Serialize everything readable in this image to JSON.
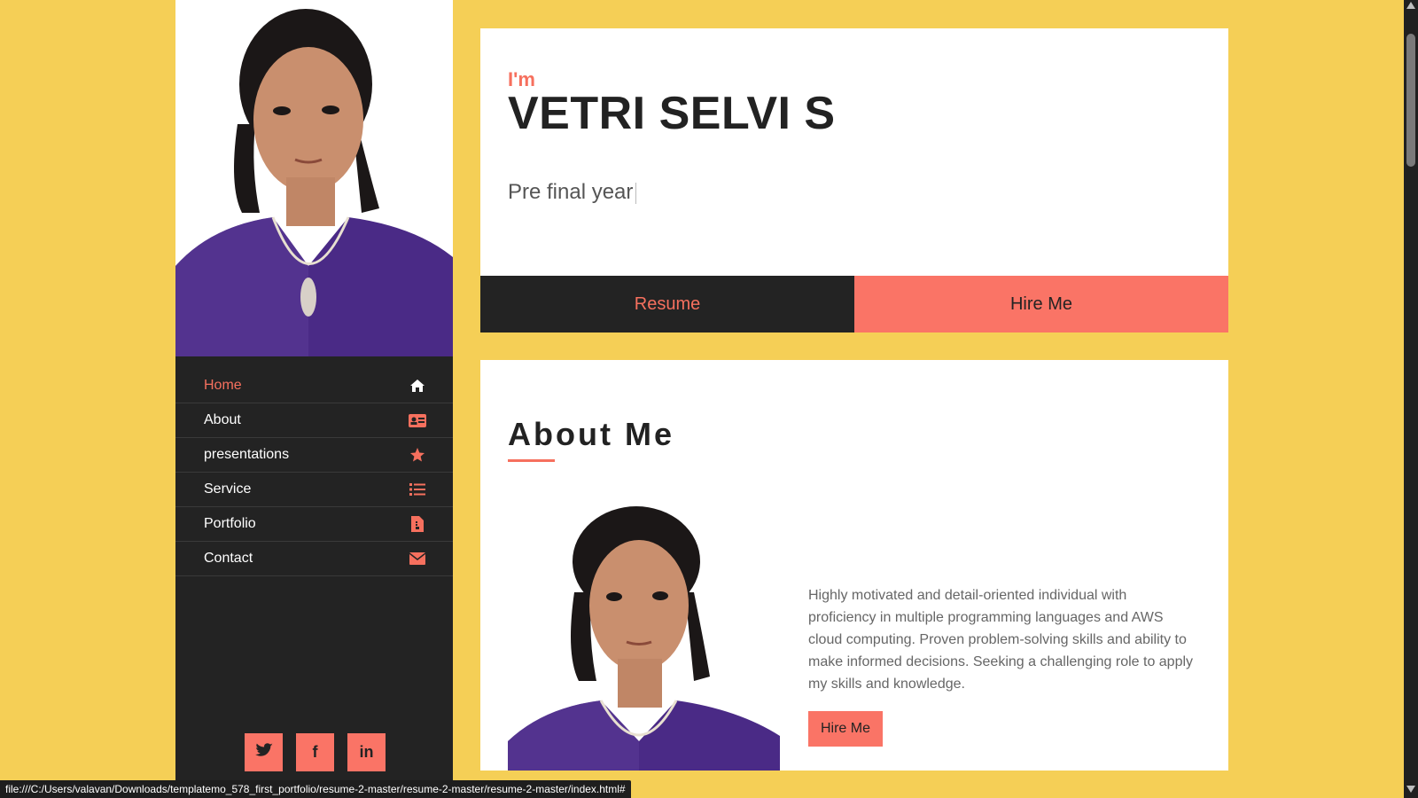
{
  "sidebar": {
    "nav": [
      {
        "label": "Home",
        "icon": "home-icon",
        "active": true
      },
      {
        "label": "About",
        "icon": "id-card-icon",
        "active": false
      },
      {
        "label": "presentations",
        "icon": "star-icon",
        "active": false
      },
      {
        "label": "Service",
        "icon": "list-icon",
        "active": false
      },
      {
        "label": "Portfolio",
        "icon": "document-icon",
        "active": false
      },
      {
        "label": "Contact",
        "icon": "envelope-icon",
        "active": false
      }
    ],
    "socials": [
      {
        "icon": "twitter-icon"
      },
      {
        "icon": "facebook-icon",
        "label": "f"
      },
      {
        "icon": "linkedin-icon",
        "label": "in"
      }
    ]
  },
  "hero": {
    "intro": "I'm",
    "name": "VETRI SELVI S",
    "subtitle": "Pre final year",
    "resume_label": "Resume",
    "hire_label": "Hire Me"
  },
  "about": {
    "title": "About Me",
    "text": "Highly motivated and detail-oriented individual with proficiency in multiple programming languages and AWS cloud computing. Proven problem-solving skills and ability to make informed decisions. Seeking a challenging role to apply my skills and knowledge.",
    "hire_label": "Hire Me"
  },
  "status_bar": {
    "url": "file:///C:/Users/valavan/Downloads/templatemo_578_first_portfolio/resume-2-master/resume-2-master/resume-2-master/index.html#"
  },
  "colors": {
    "background": "#f5cf56",
    "accent": "#f6705e",
    "accent_button": "#fa7466",
    "dark": "#232323",
    "card": "#ffffff"
  }
}
